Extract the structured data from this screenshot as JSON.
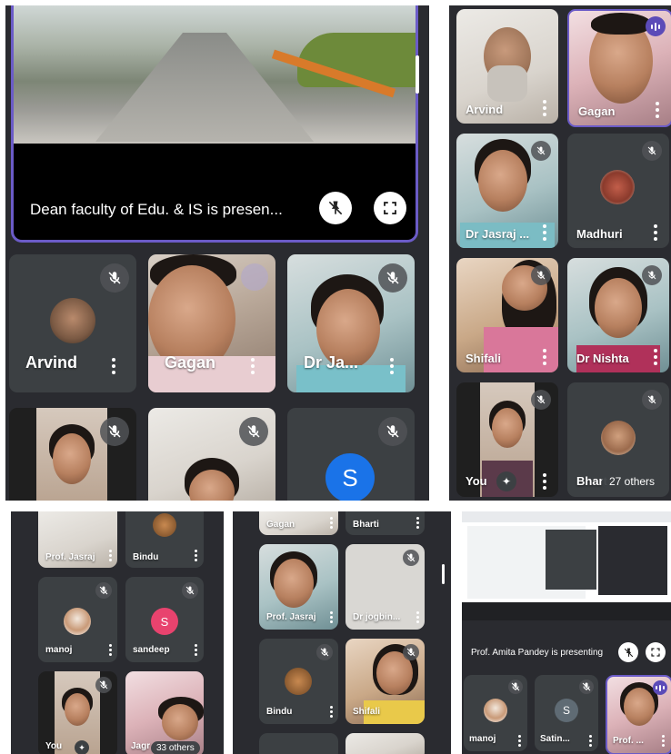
{
  "colors": {
    "bg": "#2a2b30",
    "tile": "#3c4043",
    "speaking": "#5b4bb8",
    "letter_s_blue": "#1a73e8",
    "letter_s_pink": "#e8436e",
    "letter_s_gray": "#5f6b74"
  },
  "panel1": {
    "presentation_label": "Dean faculty of Edu. & IS is presen...",
    "tiles": [
      {
        "name": "Arvind"
      },
      {
        "name": "Gagan"
      },
      {
        "name": "Dr Ja..."
      },
      {
        "name": ""
      },
      {
        "name": ""
      },
      {
        "letter": "S"
      }
    ]
  },
  "panel2": {
    "tiles": [
      {
        "name": "Arvind"
      },
      {
        "name": "Gagan"
      },
      {
        "name": "Dr Jasraj ..."
      },
      {
        "name": "Madhuri"
      },
      {
        "name": "Shifali"
      },
      {
        "name": "Dr Nishta"
      },
      {
        "name": "You"
      },
      {
        "name": "Bhart"
      }
    ],
    "others_label": "27 others"
  },
  "panel3": {
    "tiles": [
      {
        "name": "Prof. Jasraj"
      },
      {
        "name": "Bindu"
      },
      {
        "name": "manoj"
      },
      {
        "name": "sandeep",
        "letter": "S"
      },
      {
        "name": "You"
      },
      {
        "name": "Jagr"
      }
    ],
    "others_label": "33 others"
  },
  "panel4": {
    "tiles": [
      {
        "name": "Gagan"
      },
      {
        "name": "Bharti"
      },
      {
        "name": "Prof. Jasraj"
      },
      {
        "name": "Dr jogbin..."
      },
      {
        "name": "Bindu"
      },
      {
        "name": "Shifali"
      }
    ]
  },
  "panel5": {
    "presentation_label": "Prof. Amita Pandey is presenting",
    "tiles": [
      {
        "name": "manoj"
      },
      {
        "name": "Satin...",
        "letter": "S"
      },
      {
        "name": "Prof. ..."
      }
    ]
  }
}
